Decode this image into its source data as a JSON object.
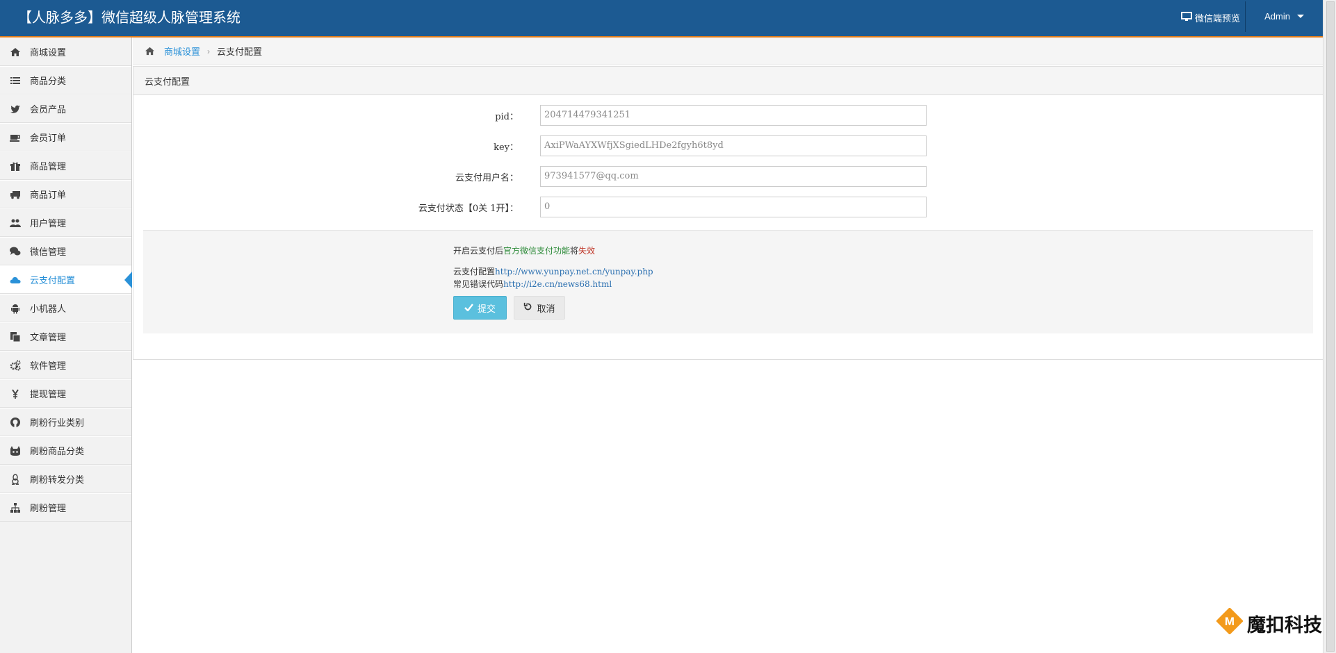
{
  "header": {
    "title": "【人脉多多】微信超级人脉管理系统",
    "preview_label": "微信端预览",
    "admin_label": "Admin"
  },
  "sidebar": {
    "items": [
      {
        "label": "商城设置",
        "icon": "home-icon"
      },
      {
        "label": "商品分类",
        "icon": "list-icon"
      },
      {
        "label": "会员产品",
        "icon": "twitter-icon"
      },
      {
        "label": "会员订单",
        "icon": "coffee-icon"
      },
      {
        "label": "商品管理",
        "icon": "gift-icon"
      },
      {
        "label": "商品订单",
        "icon": "truck-icon"
      },
      {
        "label": "用户管理",
        "icon": "users-icon"
      },
      {
        "label": "微信管理",
        "icon": "comments-icon"
      },
      {
        "label": "云支付配置",
        "icon": "cloud-icon",
        "active": true
      },
      {
        "label": "小机器人",
        "icon": "android-icon"
      },
      {
        "label": "文章管理",
        "icon": "files-icon"
      },
      {
        "label": "软件管理",
        "icon": "cogs-icon"
      },
      {
        "label": "提现管理",
        "icon": "yen-icon"
      },
      {
        "label": "刷粉行业类别",
        "icon": "github-icon"
      },
      {
        "label": "刷粉商品分类",
        "icon": "gitlab-icon"
      },
      {
        "label": "刷粉转发分类",
        "icon": "linux-icon"
      },
      {
        "label": "刷粉管理",
        "icon": "sitemap-icon"
      }
    ]
  },
  "breadcrumb": {
    "home_link": "商城设置",
    "current": "云支付配置"
  },
  "panel": {
    "title": "云支付配置",
    "fields": [
      {
        "label": "pid：",
        "value": "204714479341251"
      },
      {
        "label": "key：",
        "value": "AxiPWaAYXWfjXSgiedLHDe2fgyh6t8yd"
      },
      {
        "label": "云支付用户名：",
        "value": "973941577@qq.com"
      },
      {
        "label": "云支付状态【0关 1开】：",
        "value": "0"
      }
    ],
    "notice": {
      "prefix": "开启云支付后",
      "highlight": "官方微信支付功能",
      "middle": "将",
      "warn": "失效"
    },
    "config_label": "云支付配置",
    "config_url": "http://www.yunpay.net.cn/yunpay.php",
    "error_label": "常见错误代码",
    "error_url": "http://i2e.cn/news68.html",
    "submit_label": "提交",
    "cancel_label": "取消"
  },
  "watermark": "魔扣科技",
  "colors": {
    "header_bg": "#1c5a92",
    "header_border": "#e07b1a",
    "active": "#2a91d8",
    "submit": "#5bc0de"
  }
}
